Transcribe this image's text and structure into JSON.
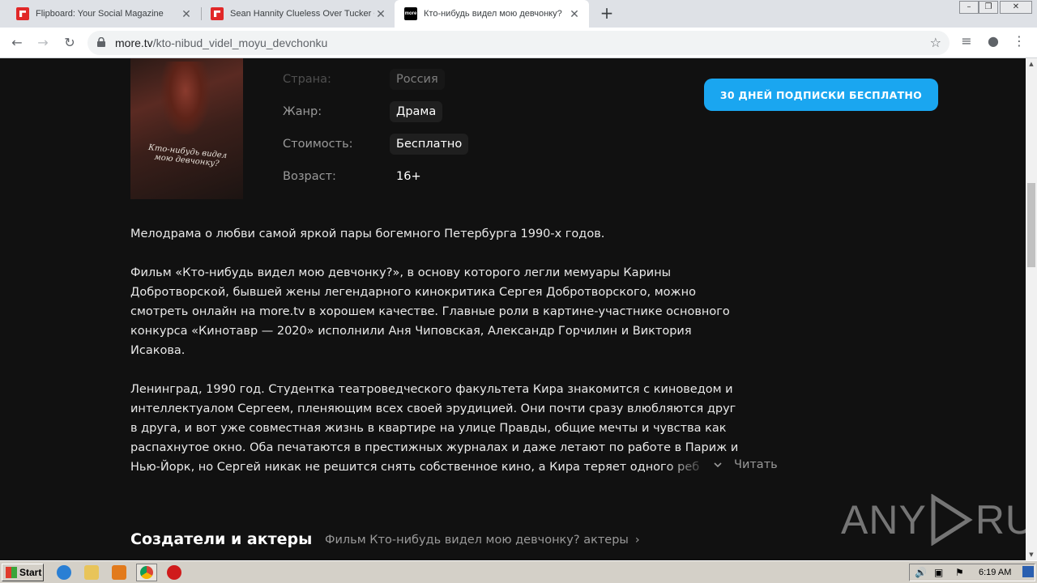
{
  "browser": {
    "tabs": [
      {
        "title": "Flipboard: Your Social Magazine",
        "favicon": "flipboard-icon"
      },
      {
        "title": "Sean Hannity Clueless Over Tucker C",
        "favicon": "flipboard-icon"
      },
      {
        "title": "Кто-нибудь видел мою девчонку?",
        "favicon": "more-tv-icon"
      }
    ],
    "favicon_text_more": "more",
    "url_host": "more.tv",
    "url_path": "/kto-nibud_videl_moyu_devchonku"
  },
  "meta": {
    "country_label": "Страна:",
    "country_value": "Россия",
    "genre_label": "Жанр:",
    "genre_value": "Драма",
    "price_label": "Стоимость:",
    "price_value": "Бесплатно",
    "age_label": "Возраст:",
    "age_value": "16+"
  },
  "poster_title": "Кто-нибудь видел мою девчонку?",
  "subscribe_label": "30 ДНЕЙ ПОДПИСКИ БЕСПЛАТНО",
  "description": {
    "p1": "Мелодрама о любви самой яркой пары богемного Петербурга 1990-х годов.",
    "p2_l1": "Фильм «Кто-нибудь видел мою девчонку?», в основу которого легли мемуары Карины",
    "p2_l2": "Добротворской, бывшей жены легендарного кинокритика Сергея Добротворского, можно",
    "p2_l3": "смотреть онлайн на more.tv в хорошем качестве. Главные роли в картине-участнике основного",
    "p2_l4": "конкурса «Кинотавр — 2020» исполнили Аня Чиповская, Александр Горчилин и Виктория",
    "p2_l5": "Исакова.",
    "p3_l1": "Ленинград, 1990 год. Студентка театроведческого факультета Кира знакомится с киноведом и",
    "p3_l2": "интеллектуалом Сергеем, пленяющим всех своей эрудицией. Они почти сразу влюбляются друг",
    "p3_l3": "в друга, и вот уже совместная жизнь в квартире на улице Правды, общие мечты и чувства как",
    "p3_l4": "распахнутое окно. Оба печатаются в престижных журналах и даже летают по работе в Париж и",
    "p3_l5": "Нью-Йорк, но Сергей никак не решится снять собственное кино, а Кира теряет одного реб"
  },
  "read_more": "Читать",
  "cast_section": {
    "title": "Создатели и актеры",
    "link": "Фильм Кто-нибудь видел мою девчонку? актеры"
  },
  "watermark": {
    "left": "ANY",
    "right": "RUN"
  },
  "taskbar": {
    "start": "Start",
    "clock": "6:19 AM"
  },
  "colors": {
    "accent": "#1aa6f0",
    "page_bg": "#111111"
  }
}
